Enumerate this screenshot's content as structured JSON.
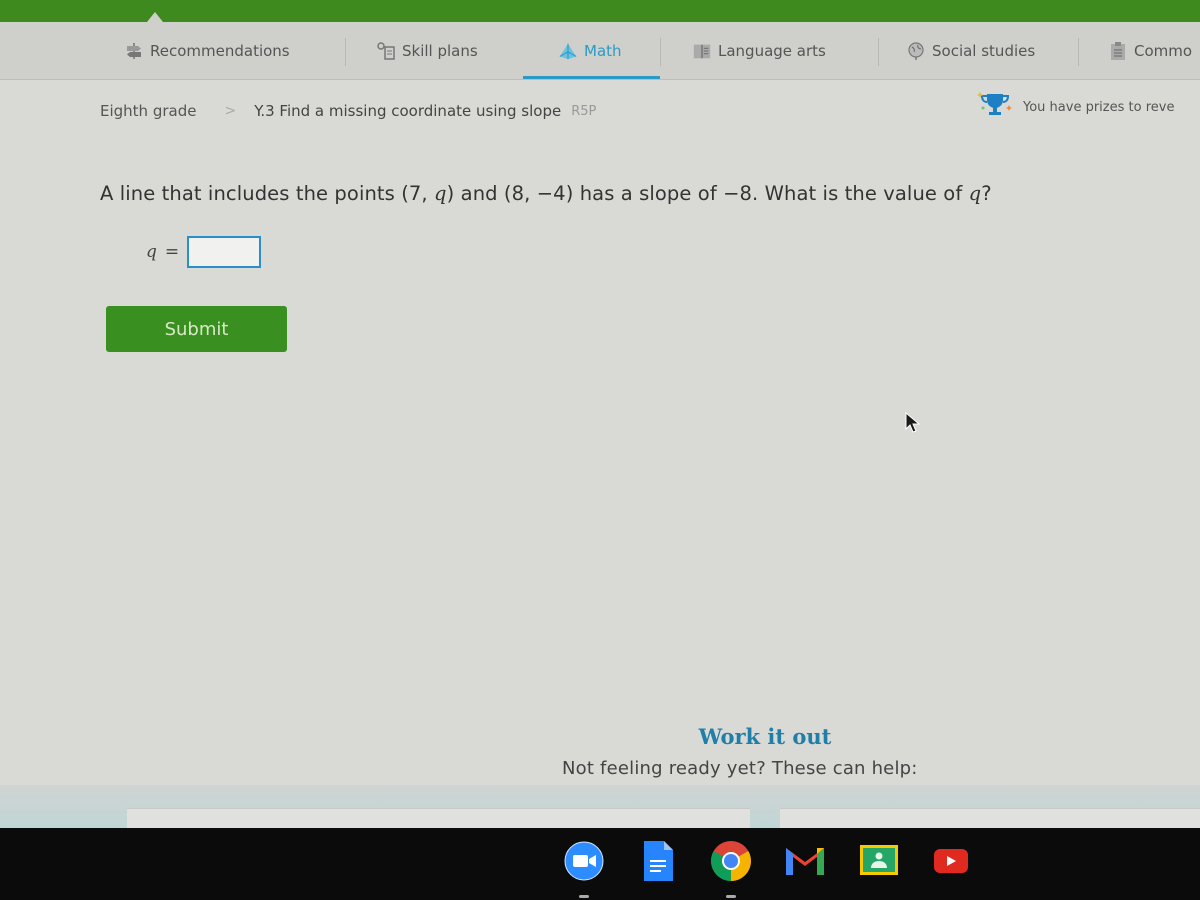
{
  "nav": {
    "items": [
      {
        "label": "Recommendations",
        "icon": "signpost-icon",
        "active": false
      },
      {
        "label": "Skill plans",
        "icon": "skill-plans-icon",
        "active": false
      },
      {
        "label": "Math",
        "icon": "pyramid-icon",
        "active": true
      },
      {
        "label": "Language arts",
        "icon": "book-icon",
        "active": false
      },
      {
        "label": "Social studies",
        "icon": "globe-icon",
        "active": false
      },
      {
        "label": "Commo",
        "icon": "clipboard-icon",
        "active": false
      }
    ]
  },
  "breadcrumb": {
    "grade": "Eighth grade",
    "skill": "Y.3 Find a missing coordinate using slope",
    "code": "R5P"
  },
  "prizes": {
    "text": "You have prizes to reve",
    "icon": "trophy-icon"
  },
  "question": {
    "prefix": "A line that includes the points (7, ",
    "var1": "q",
    "middle": ") and (8, −4) has a slope of −8. What is the value of ",
    "var2": "q",
    "suffix": "?"
  },
  "answer": {
    "variable": "q",
    "equals": "=",
    "value": ""
  },
  "submit_label": "Submit",
  "work_it_out": {
    "title": "Work it out",
    "subtitle": "Not feeling ready yet? These can help:"
  },
  "shelf": {
    "apps": [
      {
        "name": "Zoom",
        "icon": "zoom-icon",
        "running": true
      },
      {
        "name": "Google Docs",
        "icon": "docs-icon",
        "running": false
      },
      {
        "name": "Chrome",
        "icon": "chrome-icon",
        "running": true
      },
      {
        "name": "Gmail",
        "icon": "gmail-icon",
        "running": false
      },
      {
        "name": "Google Classroom",
        "icon": "classroom-icon",
        "running": false
      },
      {
        "name": "YouTube",
        "icon": "youtube-icon",
        "running": false
      }
    ]
  },
  "colors": {
    "brand_green": "#3f8a1f",
    "accent_blue": "#2a9bc7",
    "submit_green": "#3a8f21"
  }
}
